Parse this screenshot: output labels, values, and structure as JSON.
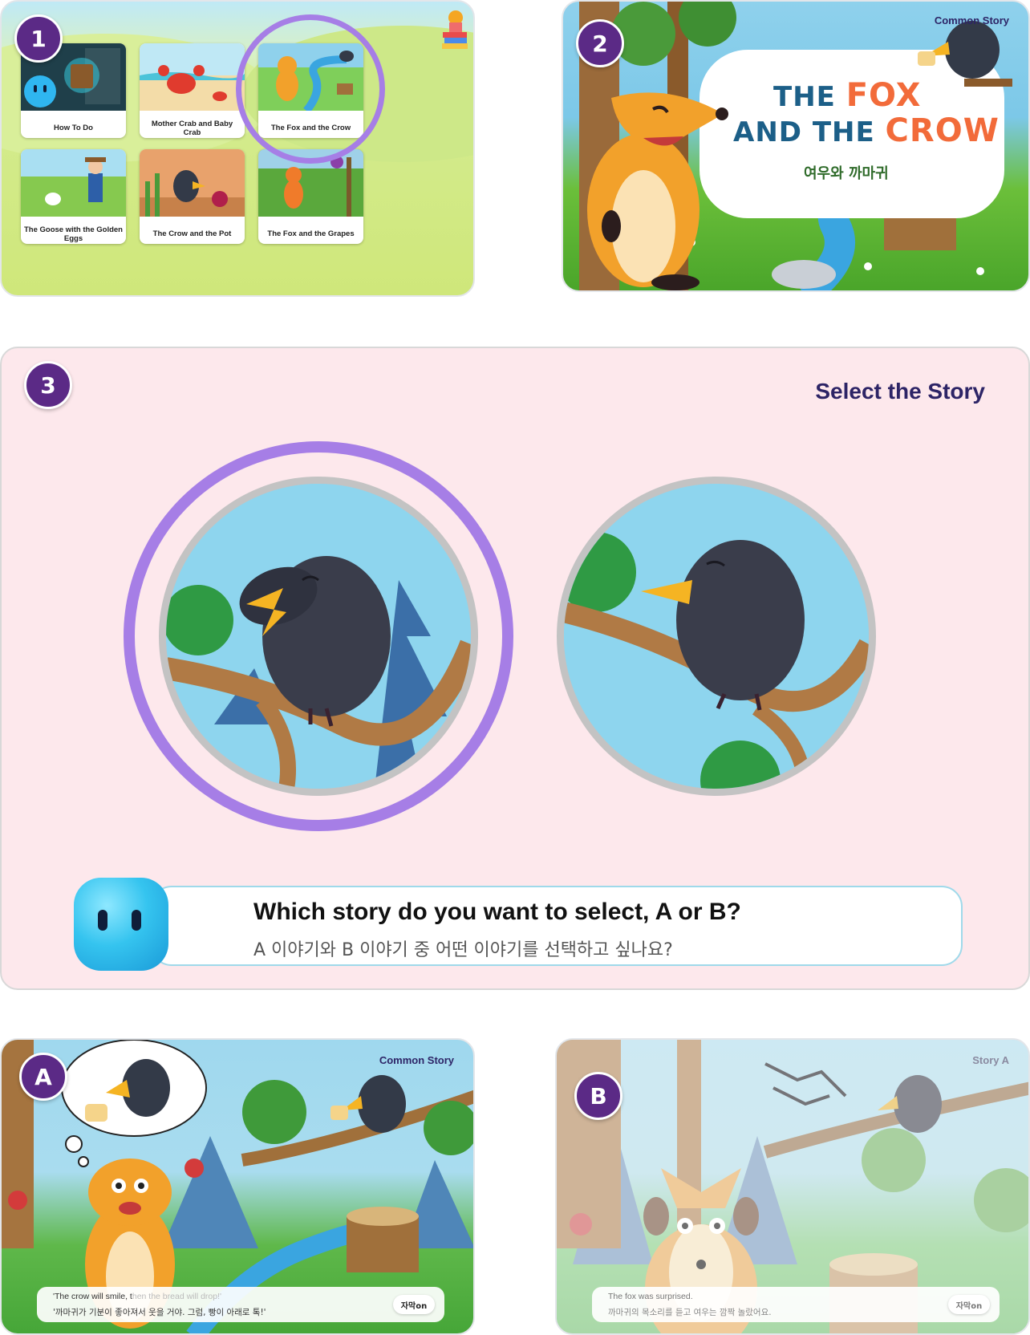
{
  "badges": {
    "p1": "1",
    "p2": "2",
    "p3": "3",
    "pA": "A",
    "pB": "B"
  },
  "menu": {
    "cards": [
      {
        "caption": "How To Do"
      },
      {
        "caption": "Mother Crab and Baby Crab"
      },
      {
        "caption": "The Fox and the Crow"
      },
      {
        "caption": "The Goose with the Golden Eggs"
      },
      {
        "caption": "The Crow and the Pot"
      },
      {
        "caption": "The Fox and the Grapes"
      }
    ]
  },
  "cover": {
    "label": "Common Story",
    "title_the1": "THE",
    "title_fox": "FOX",
    "title_and_the": "AND THE",
    "title_crow": "CROW",
    "subtitle_ko": "여우와 까마귀"
  },
  "select": {
    "heading": "Select the Story",
    "question_en": "Which story do you want to select, A or B?",
    "question_ko": "A 이야기와 B 이야기 중 어떤 이야기를 선택하고 싶나요?"
  },
  "storyA": {
    "label": "Common Story",
    "caption_en_main": "'The crow will smile, t",
    "caption_en_faded": "hen the bread will drop!'",
    "caption_ko": "'까마귀가 기분이 좋아져서 웃을 거야. 그럼, 빵이 아래로 톡!'",
    "caption_button": "자막on"
  },
  "storyB": {
    "label": "Story A",
    "caption_en": "The fox was surprised.",
    "caption_ko": "까마귀의 목소리를 듣고 여우는 깜짝 놀랐어요.",
    "caption_button": "자막on"
  },
  "colors": {
    "badge": "#5b2a86",
    "selection_ring": "#a67ee6",
    "heading": "#2d2466",
    "panel3_bg": "#fde8ec"
  }
}
